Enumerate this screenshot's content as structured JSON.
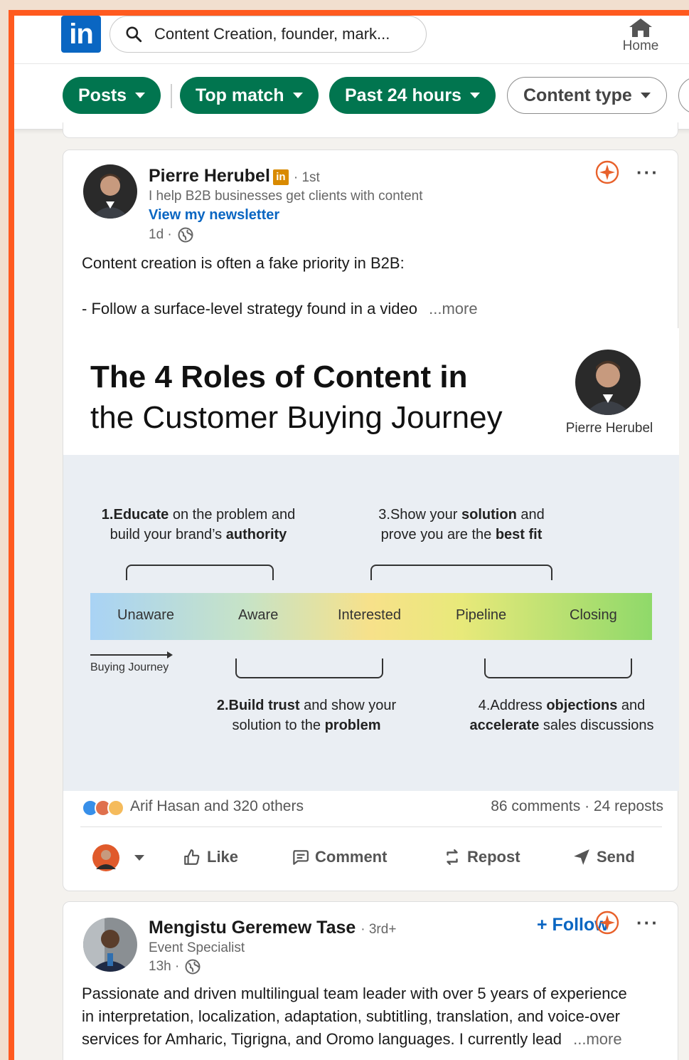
{
  "nav": {
    "logo": "in",
    "search_value": "Content Creation, founder, mark...",
    "home_label": "Home"
  },
  "filters": [
    {
      "label": "Posts",
      "active": true
    },
    {
      "label": "Top match",
      "active": true
    },
    {
      "label": "Past 24 hours",
      "active": true
    },
    {
      "label": "Content type",
      "active": false
    }
  ],
  "post1": {
    "author": "Pierre Herubel",
    "badge": "in",
    "degree": "· 1st",
    "headline": "I help B2B businesses get clients with content",
    "newsletter_link": "View my newsletter",
    "time": "1d ·",
    "text_line1": "Content creation is often a fake priority in B2B:",
    "text_line2": "- Follow a surface-level strategy found in a video",
    "more": "...more",
    "infographic": {
      "title_line1_bold": "The 4 Roles of Content in",
      "title_line2": "the Customer Buying Journey",
      "author_caption": "Pierre Herubel",
      "phase1_line1_num": "1.",
      "phase1_line1_bold": "Educate",
      "phase1_line1_rest": " on the problem and",
      "phase1_line2_pre": "build your brand’s ",
      "phase1_line2_bold": "authority",
      "phase3_line1_pre": "3.Show your ",
      "phase3_line1_bold": "solution",
      "phase3_line1_rest": " and",
      "phase3_line2_pre": "prove you are the ",
      "phase3_line2_bold": "best fit",
      "stages": [
        "Unaware",
        "Aware",
        "Interested",
        "Pipeline",
        "Closing"
      ],
      "journey_label": "Buying Journey",
      "phase2_line1_num": "2.",
      "phase2_line1_bold": "Build trust",
      "phase2_line1_rest": " and show your",
      "phase2_line2_pre": "solution to the ",
      "phase2_line2_bold": "problem",
      "phase4_line1_pre": "4.Address ",
      "phase4_line1_bold": "objections",
      "phase4_line1_rest": " and",
      "phase4_line2_bold": "accelerate",
      "phase4_line2_rest": " sales discussions"
    },
    "reactions_text": "Arif Hasan and 320 others",
    "counts_text": "86 comments · 24 reposts",
    "actions": {
      "like": "Like",
      "comment": "Comment",
      "repost": "Repost",
      "send": "Send"
    }
  },
  "post2": {
    "author": "Mengistu Geremew Tase",
    "degree": "· 3rd+",
    "headline": "Event Specialist",
    "time": "13h ·",
    "follow": "+ Follow",
    "text_line1": "Passionate and driven multilingual team leader with over 5 years of experience",
    "text_line2": "in interpretation, localization, adaptation, subtitling, translation, and voice-over",
    "text_line3": "services for Amharic, Tigrigna, and Oromo languages. I currently lead",
    "more": "...more"
  },
  "colors": {
    "frame": "#ff5a1f",
    "linkedin_blue": "#0a66c2",
    "filter_green": "#01754f",
    "premium_orange": "#e8612b"
  }
}
